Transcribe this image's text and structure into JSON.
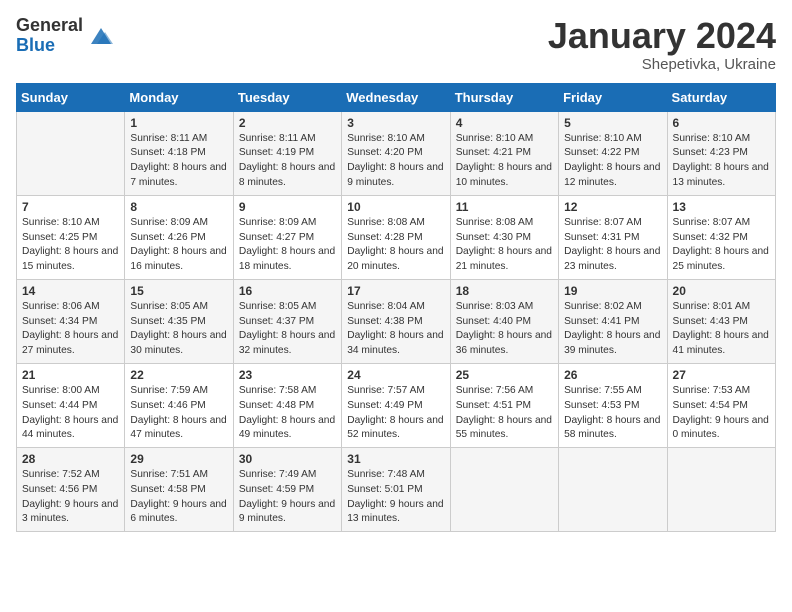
{
  "header": {
    "logo_line1": "General",
    "logo_line2": "Blue",
    "month": "January 2024",
    "location": "Shepetivka, Ukraine"
  },
  "days_of_week": [
    "Sunday",
    "Monday",
    "Tuesday",
    "Wednesday",
    "Thursday",
    "Friday",
    "Saturday"
  ],
  "weeks": [
    [
      {
        "day": "",
        "sunrise": "",
        "sunset": "",
        "daylight": ""
      },
      {
        "day": "1",
        "sunrise": "8:11 AM",
        "sunset": "4:18 PM",
        "daylight": "8 hours and 7 minutes."
      },
      {
        "day": "2",
        "sunrise": "8:11 AM",
        "sunset": "4:19 PM",
        "daylight": "8 hours and 8 minutes."
      },
      {
        "day": "3",
        "sunrise": "8:10 AM",
        "sunset": "4:20 PM",
        "daylight": "8 hours and 9 minutes."
      },
      {
        "day": "4",
        "sunrise": "8:10 AM",
        "sunset": "4:21 PM",
        "daylight": "8 hours and 10 minutes."
      },
      {
        "day": "5",
        "sunrise": "8:10 AM",
        "sunset": "4:22 PM",
        "daylight": "8 hours and 12 minutes."
      },
      {
        "day": "6",
        "sunrise": "8:10 AM",
        "sunset": "4:23 PM",
        "daylight": "8 hours and 13 minutes."
      }
    ],
    [
      {
        "day": "7",
        "sunrise": "8:10 AM",
        "sunset": "4:25 PM",
        "daylight": "8 hours and 15 minutes."
      },
      {
        "day": "8",
        "sunrise": "8:09 AM",
        "sunset": "4:26 PM",
        "daylight": "8 hours and 16 minutes."
      },
      {
        "day": "9",
        "sunrise": "8:09 AM",
        "sunset": "4:27 PM",
        "daylight": "8 hours and 18 minutes."
      },
      {
        "day": "10",
        "sunrise": "8:08 AM",
        "sunset": "4:28 PM",
        "daylight": "8 hours and 20 minutes."
      },
      {
        "day": "11",
        "sunrise": "8:08 AM",
        "sunset": "4:30 PM",
        "daylight": "8 hours and 21 minutes."
      },
      {
        "day": "12",
        "sunrise": "8:07 AM",
        "sunset": "4:31 PM",
        "daylight": "8 hours and 23 minutes."
      },
      {
        "day": "13",
        "sunrise": "8:07 AM",
        "sunset": "4:32 PM",
        "daylight": "8 hours and 25 minutes."
      }
    ],
    [
      {
        "day": "14",
        "sunrise": "8:06 AM",
        "sunset": "4:34 PM",
        "daylight": "8 hours and 27 minutes."
      },
      {
        "day": "15",
        "sunrise": "8:05 AM",
        "sunset": "4:35 PM",
        "daylight": "8 hours and 30 minutes."
      },
      {
        "day": "16",
        "sunrise": "8:05 AM",
        "sunset": "4:37 PM",
        "daylight": "8 hours and 32 minutes."
      },
      {
        "day": "17",
        "sunrise": "8:04 AM",
        "sunset": "4:38 PM",
        "daylight": "8 hours and 34 minutes."
      },
      {
        "day": "18",
        "sunrise": "8:03 AM",
        "sunset": "4:40 PM",
        "daylight": "8 hours and 36 minutes."
      },
      {
        "day": "19",
        "sunrise": "8:02 AM",
        "sunset": "4:41 PM",
        "daylight": "8 hours and 39 minutes."
      },
      {
        "day": "20",
        "sunrise": "8:01 AM",
        "sunset": "4:43 PM",
        "daylight": "8 hours and 41 minutes."
      }
    ],
    [
      {
        "day": "21",
        "sunrise": "8:00 AM",
        "sunset": "4:44 PM",
        "daylight": "8 hours and 44 minutes."
      },
      {
        "day": "22",
        "sunrise": "7:59 AM",
        "sunset": "4:46 PM",
        "daylight": "8 hours and 47 minutes."
      },
      {
        "day": "23",
        "sunrise": "7:58 AM",
        "sunset": "4:48 PM",
        "daylight": "8 hours and 49 minutes."
      },
      {
        "day": "24",
        "sunrise": "7:57 AM",
        "sunset": "4:49 PM",
        "daylight": "8 hours and 52 minutes."
      },
      {
        "day": "25",
        "sunrise": "7:56 AM",
        "sunset": "4:51 PM",
        "daylight": "8 hours and 55 minutes."
      },
      {
        "day": "26",
        "sunrise": "7:55 AM",
        "sunset": "4:53 PM",
        "daylight": "8 hours and 58 minutes."
      },
      {
        "day": "27",
        "sunrise": "7:53 AM",
        "sunset": "4:54 PM",
        "daylight": "9 hours and 0 minutes."
      }
    ],
    [
      {
        "day": "28",
        "sunrise": "7:52 AM",
        "sunset": "4:56 PM",
        "daylight": "9 hours and 3 minutes."
      },
      {
        "day": "29",
        "sunrise": "7:51 AM",
        "sunset": "4:58 PM",
        "daylight": "9 hours and 6 minutes."
      },
      {
        "day": "30",
        "sunrise": "7:49 AM",
        "sunset": "4:59 PM",
        "daylight": "9 hours and 9 minutes."
      },
      {
        "day": "31",
        "sunrise": "7:48 AM",
        "sunset": "5:01 PM",
        "daylight": "9 hours and 13 minutes."
      },
      {
        "day": "",
        "sunrise": "",
        "sunset": "",
        "daylight": ""
      },
      {
        "day": "",
        "sunrise": "",
        "sunset": "",
        "daylight": ""
      },
      {
        "day": "",
        "sunrise": "",
        "sunset": "",
        "daylight": ""
      }
    ]
  ],
  "labels": {
    "sunrise_prefix": "Sunrise: ",
    "sunset_prefix": "Sunset: ",
    "daylight_prefix": "Daylight: "
  }
}
